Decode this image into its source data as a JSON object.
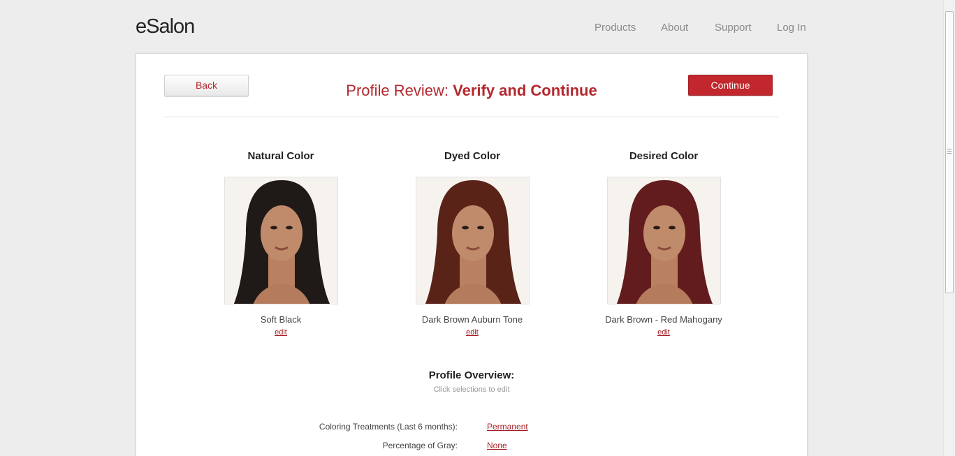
{
  "header": {
    "logo": "eSalon",
    "nav": [
      "Products",
      "About",
      "Support",
      "Log In"
    ]
  },
  "review": {
    "back_label": "Back",
    "continue_label": "Continue",
    "title_light": "Profile Review: ",
    "title_bold": "Verify and Continue"
  },
  "colors": [
    {
      "heading": "Natural Color",
      "name": "Soft Black",
      "edit": "edit",
      "hair_hex": "#1f1a18"
    },
    {
      "heading": "Dyed Color",
      "name": "Dark Brown Auburn Tone",
      "edit": "edit",
      "hair_hex": "#5a2318"
    },
    {
      "heading": "Desired Color",
      "name": "Dark Brown - Red Mahogany",
      "edit": "edit",
      "hair_hex": "#631c1d"
    }
  ],
  "overview": {
    "title": "Profile Overview:",
    "subtitle": "Click selections to edit",
    "rows": [
      {
        "label": "Coloring Treatments (Last 6 months):",
        "value": "Permanent"
      },
      {
        "label": "Percentage of Gray:",
        "value": "None"
      }
    ]
  },
  "theme": {
    "accent": "#c1272d",
    "link": "#a51d24"
  }
}
